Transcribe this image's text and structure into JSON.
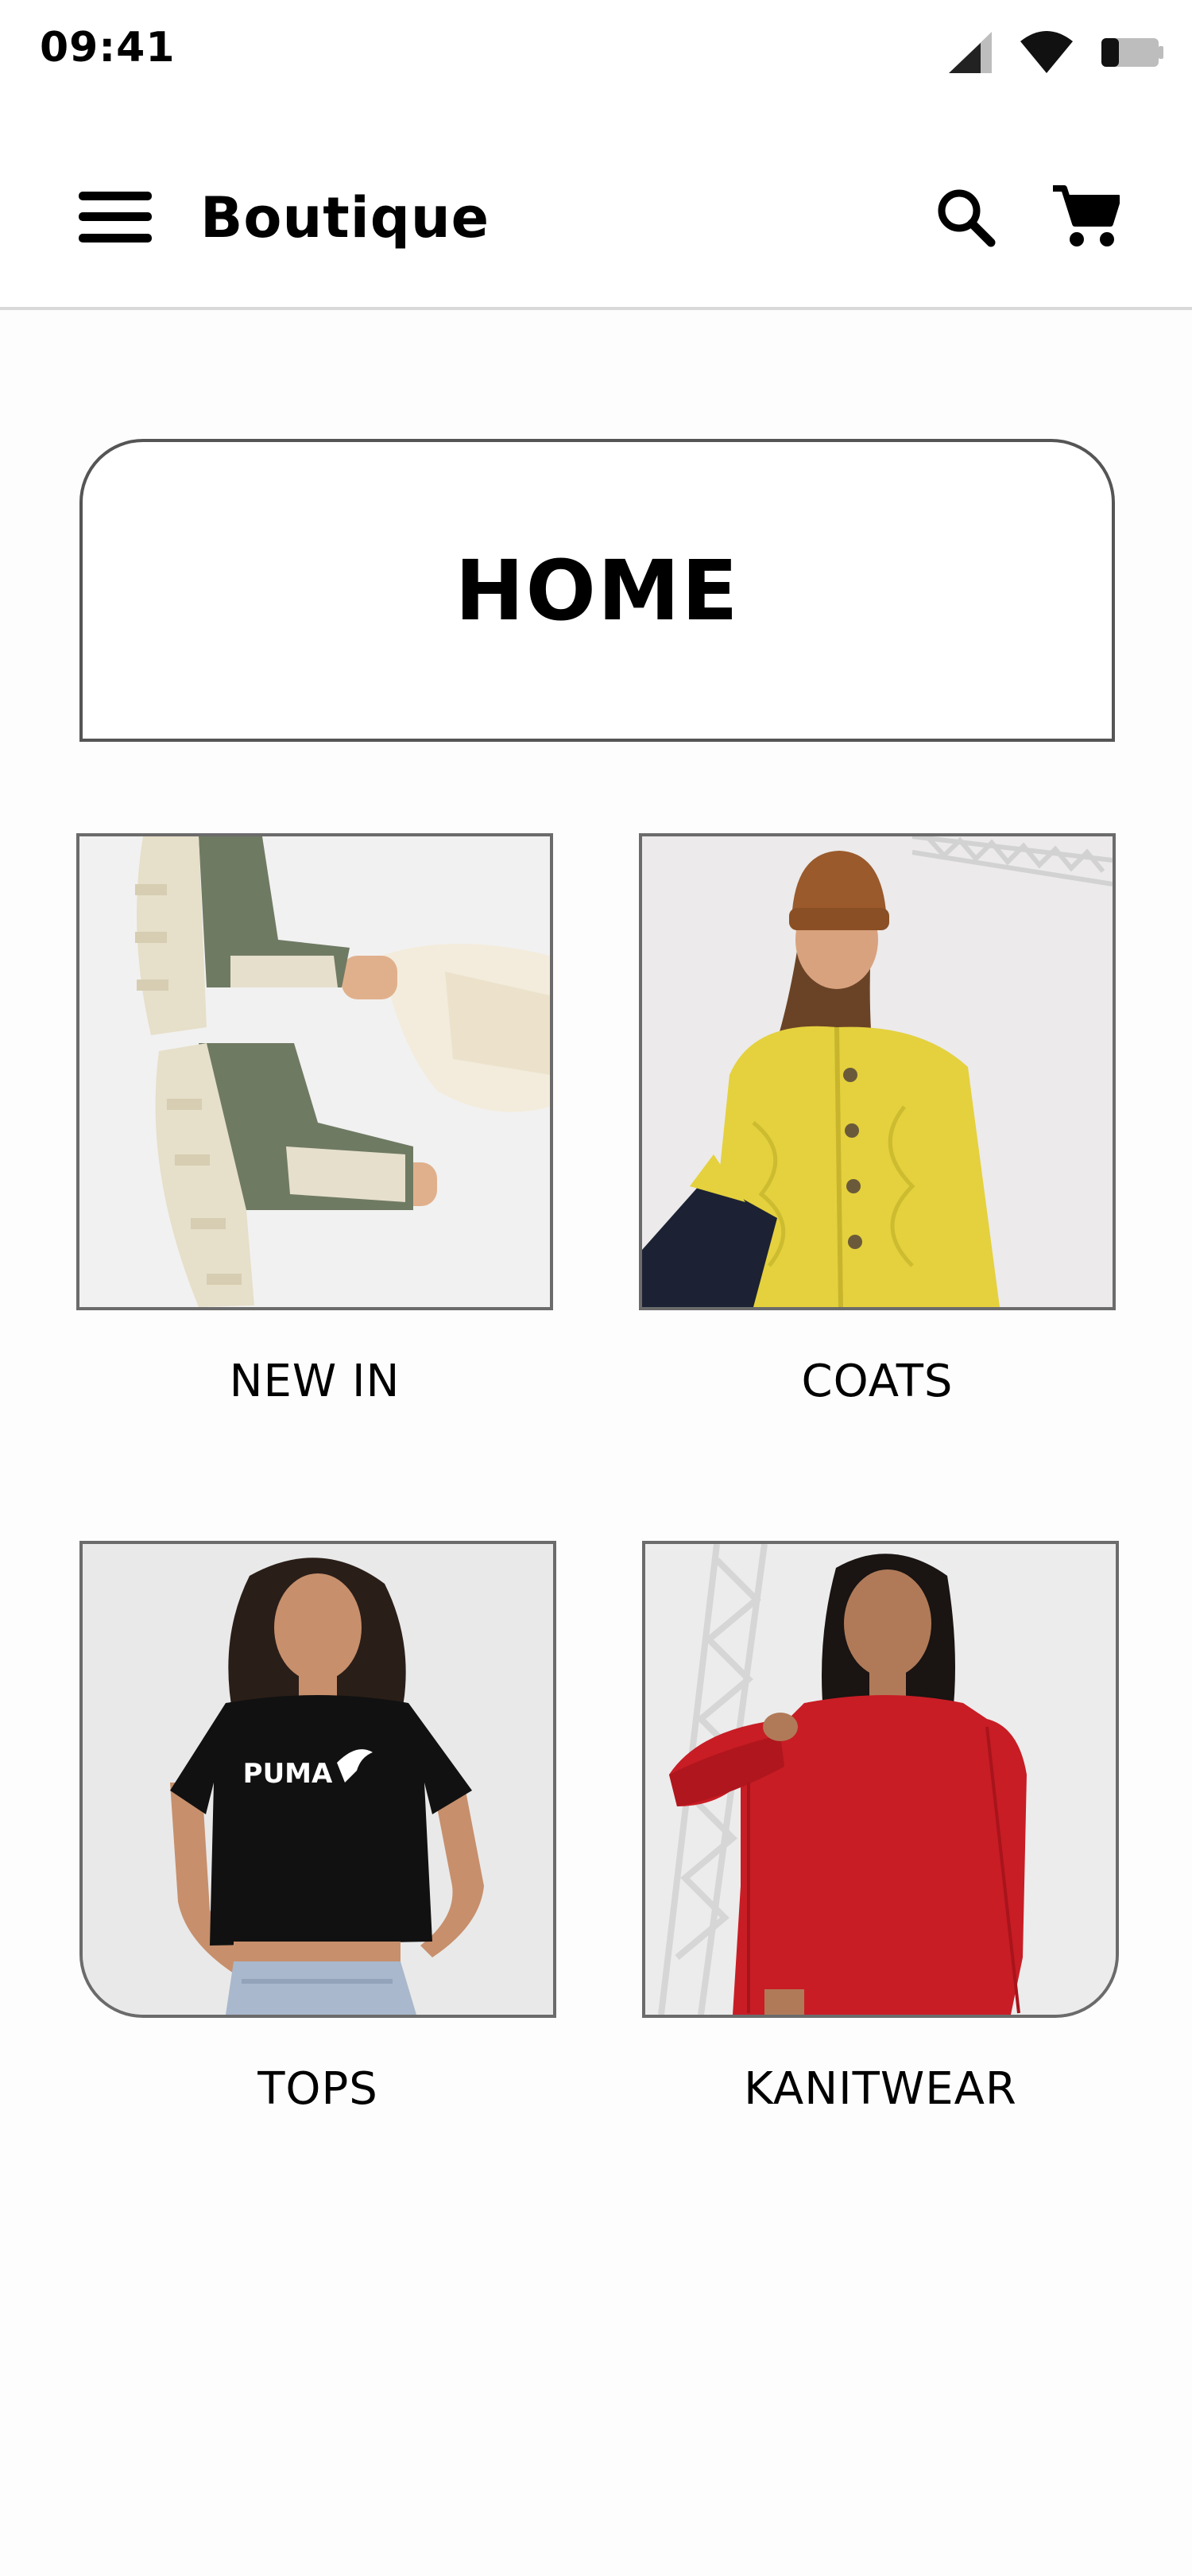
{
  "status_bar": {
    "time": "09:41",
    "icons": [
      "cellular-signal-icon",
      "wifi-icon",
      "battery-icon"
    ]
  },
  "app_bar": {
    "title": "Boutique",
    "icons": [
      "menu-icon",
      "search-icon",
      "cart-icon"
    ]
  },
  "home": {
    "title": "HOME"
  },
  "categories": [
    {
      "label": "NEW IN",
      "image": "green chelsea boots with cream lug soles"
    },
    {
      "label": "COATS",
      "image": "yellow quilted jacket with brown beanie"
    },
    {
      "label": "TOPS",
      "image": "black cropped PUMA t-shirt"
    },
    {
      "label": "KANITWEAR",
      "image": "red knit sweater dress"
    }
  ],
  "colors": {
    "background": "#fdfdfd",
    "surface": "#ffffff",
    "border": "#555555",
    "divider": "#d9d9d9",
    "text": "#000000"
  }
}
